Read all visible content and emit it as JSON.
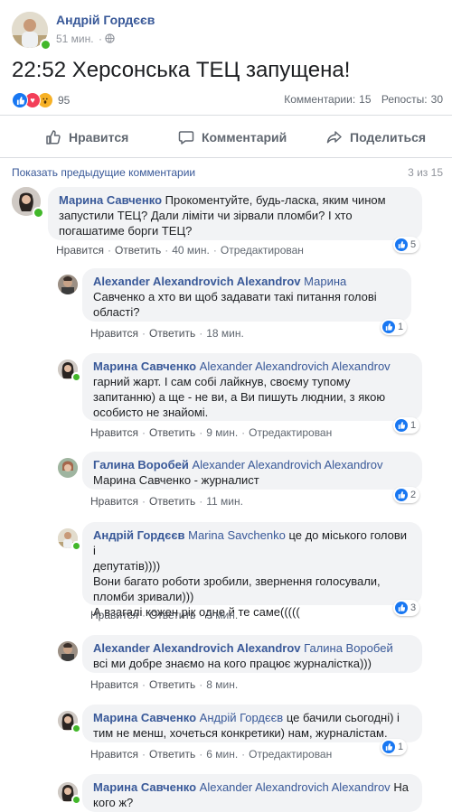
{
  "post": {
    "author": "Андрій Гордєєв",
    "time": "51 мин.",
    "text": "22:52 Херсонська ТЕЦ запущена!",
    "reactions_count": "95",
    "comments_label": "Комментарии:",
    "comments_count": "15",
    "shares_label": "Репосты:",
    "shares_count": "30"
  },
  "actions": {
    "like": "Нравится",
    "comment": "Комментарий",
    "share": "Поделиться"
  },
  "comments_header": {
    "show_previous": "Показать предыдущие комментарии",
    "pager": "3 из 15"
  },
  "comment_actions": {
    "like": "Нравится",
    "reply": "Ответить",
    "edited": "Отредактирован"
  },
  "comments": [
    {
      "name": "Марина Савченко",
      "mention": "",
      "lines": [
        "Прокоментуйте, будь-ласка, яким чином",
        "запустили ТЕЦ? Дали ліміти чи зірвали пломби? І хто",
        "погашатиме борги ТЕЦ?"
      ],
      "time": "40 мин.",
      "edited": true,
      "likes": "5"
    },
    {
      "name": "Alexander Alexandrovich Alexandrov",
      "mention": "Марина",
      "lines": [
        "Савченко а хто ви щоб задавати такі питання голові",
        "області?"
      ],
      "time": "18 мин.",
      "edited": false,
      "likes": "1"
    },
    {
      "name": "Марина Савченко",
      "mention": "Alexander Alexandrovich Alexandrov",
      "lines": [
        "гарний жарт. І сам собі лайкнув, своєму тупому",
        "запитанню) а ще - не ви, а Ви пишуть люднии, з якою",
        "особисто не знайомі."
      ],
      "time": "9 мин.",
      "edited": true,
      "likes": "1"
    },
    {
      "name": "Галина Воробей",
      "mention": "Alexander Alexandrovich Alexandrov",
      "lines": [
        "Марина Савченко - журналист"
      ],
      "time": "11 мин.",
      "edited": false,
      "likes": "2"
    },
    {
      "name": "Андрій Гордєєв",
      "mention": "Marina Savchenko",
      "lines": [
        "це до міського голови і",
        "депутатів))))",
        "Вони багато роботи зробили, звернення голосували,",
        "пломби зривали)))",
        "А взагалі кожен рік одне й те саме((((("
      ],
      "time": "9 мин.",
      "edited": false,
      "likes": "3"
    },
    {
      "name": "Alexander Alexandrovich Alexandrov",
      "mention": "Галина Воробей",
      "lines": [
        "всі ми добре знаємо на кого працює журналістка)))"
      ],
      "time": "8 мин.",
      "edited": false,
      "likes": ""
    },
    {
      "name": "Марина Савченко",
      "mention": "Андрій Гордєєв",
      "lines": [
        "це бачили сьогодні) і",
        "тим не менш, хочеться конкретики) нам, журналістам."
      ],
      "time": "6 мин.",
      "edited": true,
      "likes": "1"
    },
    {
      "name": "Марина Савченко",
      "mention": "Alexander Alexandrovich Alexandrov",
      "lines": [
        "На",
        "кого ж?"
      ],
      "time": "",
      "edited": false,
      "likes": ""
    }
  ],
  "icons": [
    "globe-icon",
    "like-reaction-icon",
    "love-reaction-icon",
    "wow-reaction-icon",
    "thumbs-up-icon",
    "comment-icon",
    "share-icon"
  ],
  "colors": {
    "link": "#385898",
    "like_blue": "#1877f2",
    "love_red": "#f33e58",
    "wow_yellow": "#f7b125",
    "online_green": "#42b72a"
  }
}
